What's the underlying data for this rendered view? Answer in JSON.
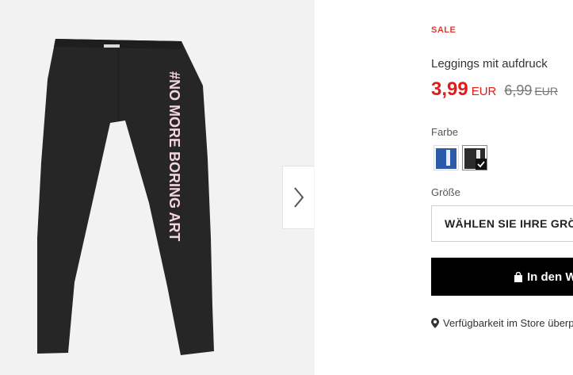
{
  "product": {
    "badge": "SALE",
    "title": "Leggings mit aufdruck",
    "price_current": "3,99",
    "currency_current": "EUR",
    "price_old": "6,99",
    "currency_old": "EUR",
    "print_text": "#NO MORE BORING ART"
  },
  "color": {
    "label": "Farbe",
    "swatches": [
      {
        "name": "blue",
        "hex": "#2a5aa8",
        "selected": false
      },
      {
        "name": "black",
        "hex": "#2b2b2b",
        "selected": true
      }
    ]
  },
  "size": {
    "label": "Größe",
    "select_text": "WÄHLEN SIE IHRE GRÖSSE"
  },
  "cart": {
    "button_label": "In den Warenkorb"
  },
  "store": {
    "link_text": "Verfügbarkeit im Store überprüfen"
  },
  "gallery": {
    "next_icon": "chevron-right-icon"
  },
  "colors": {
    "sale": "#e53935",
    "price": "#e11a1a",
    "button_bg": "#000000",
    "gallery_bg": "#f2f2f2",
    "legging": "#262626",
    "print": "#f6d6dd"
  }
}
